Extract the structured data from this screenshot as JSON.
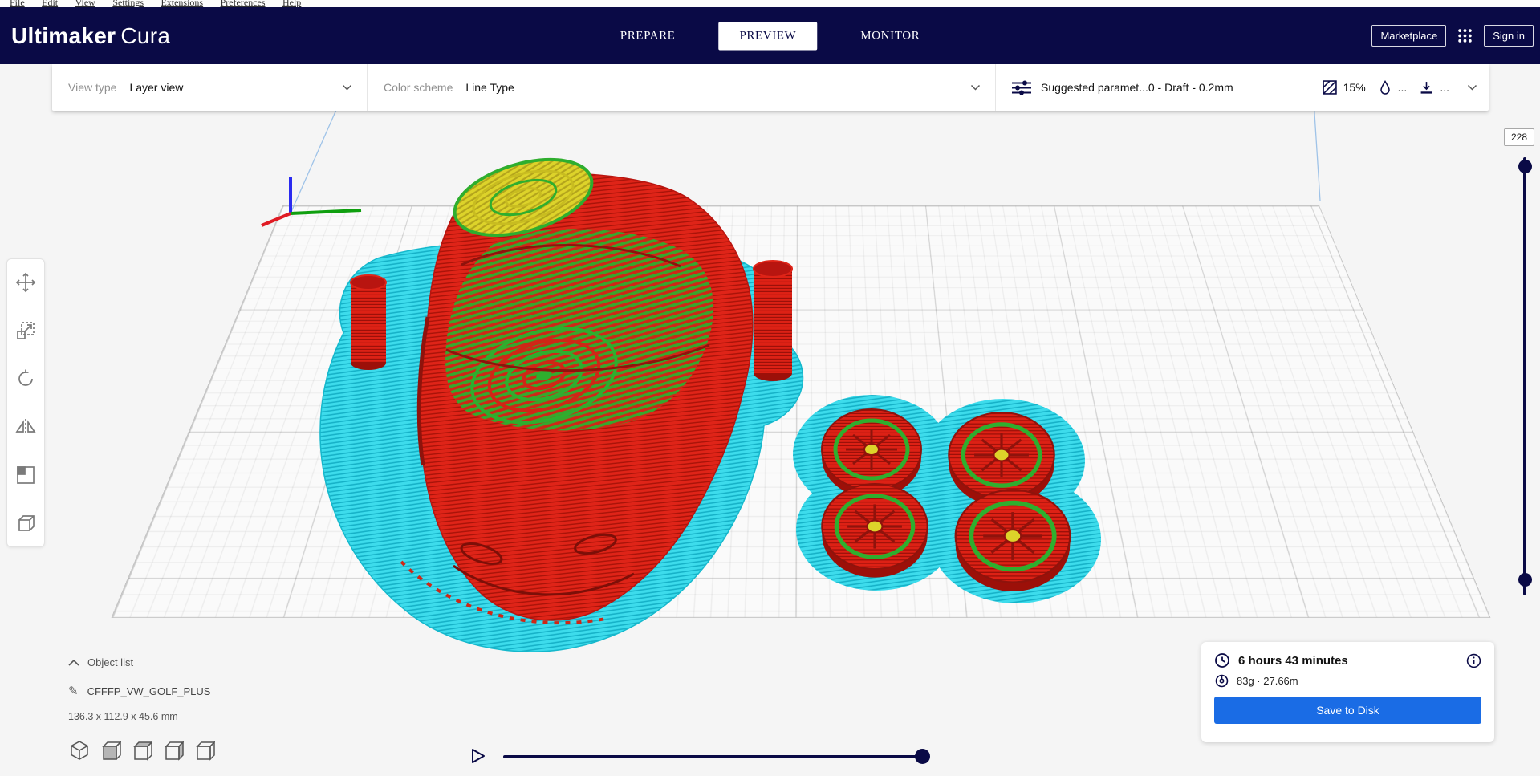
{
  "menubar": {
    "items": [
      "File",
      "Edit",
      "View",
      "Settings",
      "Extensions",
      "Preferences",
      "Help"
    ]
  },
  "header": {
    "logo_primary": "Ultimaker",
    "logo_secondary": "Cura",
    "tabs": [
      {
        "label": "PREPARE"
      },
      {
        "label": "PREVIEW"
      },
      {
        "label": "MONITOR"
      }
    ],
    "marketplace_label": "Marketplace",
    "signin_label": "Sign in"
  },
  "toolbar": {
    "view_type_label": "View type",
    "view_type_value": "Layer view",
    "color_scheme_label": "Color scheme",
    "color_scheme_value": "Line Type",
    "profile_summary": "Suggested paramet...0 - Draft - 0.2mm",
    "infill_value": "15%",
    "material_value": "...",
    "adhesion_value": "..."
  },
  "layer_slider": {
    "max_label": "228"
  },
  "object_list": {
    "title": "Object list",
    "item_name": "CFFFP_VW_GOLF_PLUS",
    "dimensions": "136.3 x 112.9 x 45.6 mm"
  },
  "print_summary": {
    "time": "6 hours 43 minutes",
    "material": "83g · 27.66m",
    "save_button": "Save to Disk"
  },
  "scene": {
    "model_name": "CFFFP_VW_GOLF_PLUS",
    "colors": {
      "shell_red": "#df2418",
      "infill_green": "#2fae2e",
      "top_yellow": "#ddd32a",
      "support_cyan": "#3ddcec",
      "header_navy": "#0a0a46",
      "accent_blue": "#1a6ce5"
    }
  }
}
